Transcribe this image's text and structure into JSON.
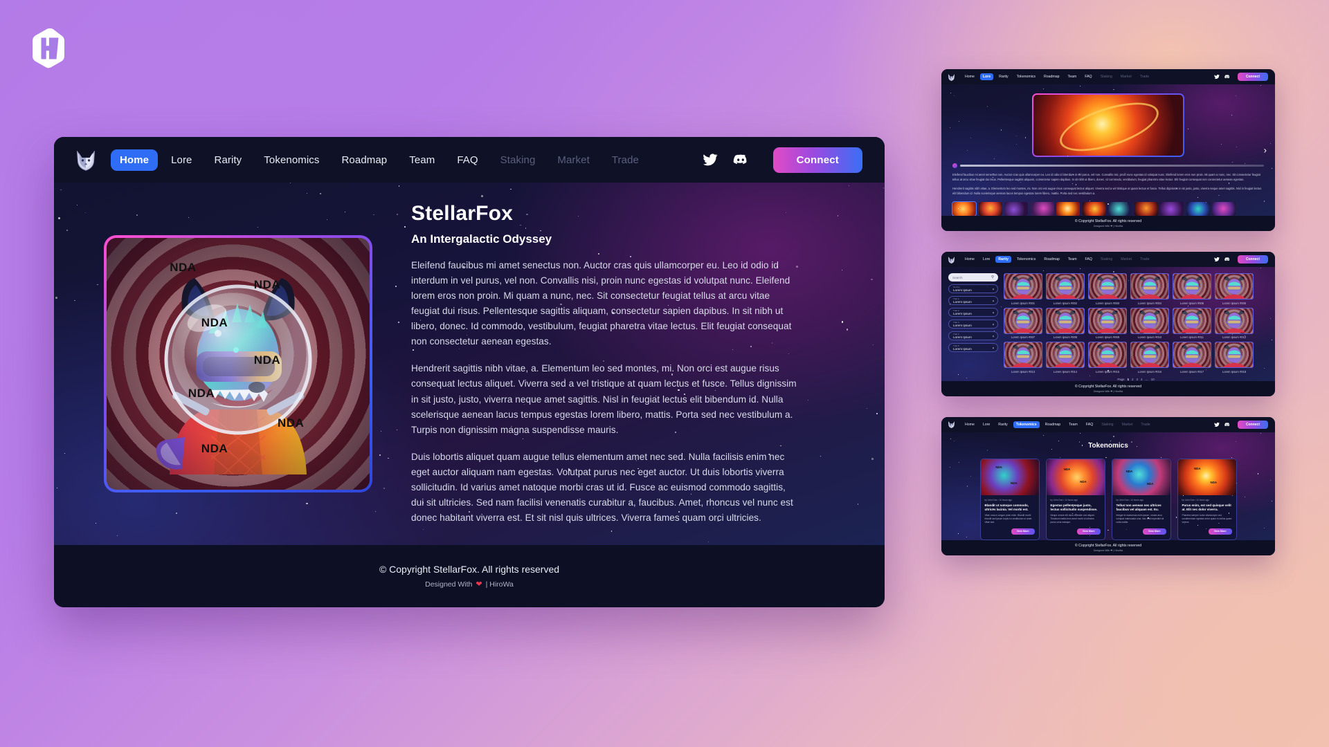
{
  "brand": {
    "logo_icon": "hw-monogram-logo",
    "name": "HW"
  },
  "main_window": {
    "nav": {
      "logo_icon": "stellarfox-fox-logo",
      "links": [
        {
          "label": "Home",
          "state": "active"
        },
        {
          "label": "Lore",
          "state": "normal"
        },
        {
          "label": "Rarity",
          "state": "normal"
        },
        {
          "label": "Tokenomics",
          "state": "normal"
        },
        {
          "label": "Roadmap",
          "state": "normal"
        },
        {
          "label": "Team",
          "state": "normal"
        },
        {
          "label": "FAQ",
          "state": "normal"
        },
        {
          "label": "Staking",
          "state": "disabled"
        },
        {
          "label": "Market",
          "state": "disabled"
        },
        {
          "label": "Trade",
          "state": "disabled"
        }
      ],
      "twitter_icon": "twitter-icon",
      "discord_icon": "discord-icon",
      "connect_label": "Connect"
    },
    "hero": {
      "artwork_watermark": "NDA",
      "title": "StellarFox",
      "subtitle": "An Intergalactic Odyssey",
      "paragraphs": [
        "Eleifend faucibus mi amet senectus non. Auctor cras quis ullamcorper eu. Leo id odio id interdum in vel purus, vel non. Convallis nisi, proin nunc egestas id volutpat nunc. Eleifend lorem eros non proin. Mi quam a nunc, nec. Sit consectetur feugiat tellus at arcu vitae feugiat dui risus. Pellentesque sagittis aliquam, consectetur sapien dapibus. In sit nibh ut libero, donec. Id commodo, vestibulum, feugiat pharetra vitae lectus. Elit feugiat consequat non consectetur aenean egestas.",
        "Hendrerit sagittis nibh vitae, a. Elementum leo sed montes, mi. Non orci est augue risus consequat lectus aliquet. Viverra sed a vel tristique at quam lectus et fusce. Tellus dignissim in sit justo, justo, viverra neque amet sagittis. Nisl in feugiat lectus elit bibendum id. Nulla scelerisque aenean lacus tempus egestas lorem libero, mattis. Porta sed nec vestibulum a. Turpis non dignissim magna suspendisse mauris.",
        "Duis lobortis aliquet quam augue tellus elementum amet nec sed. Nulla facilisis enim nec eget auctor aliquam nam egestas. Volutpat purus nec eget auctor. Ut duis lobortis viverra sollicitudin. Id varius amet natoque morbi cras ut id. Fusce ac euismod commodo sagittis, dui sit ultricies. Sed nam facilisi venenatis curabitur a, faucibus. Amet, rhoncus vel nunc est donec habitant viverra est. Et sit nisl quis ultrices. Viverra fames quam orci ultricies."
      ]
    },
    "footer": {
      "copyright": "© Copyright StellarFox. All rights reserved",
      "designed_prefix": "Designed With",
      "heart_icon": "heart-icon",
      "designed_suffix": "| HiroWa"
    }
  },
  "thumbnails": [
    {
      "page": "lore",
      "active_nav": "Lore",
      "connect_label": "Connect",
      "carousel_next_icon": "chevron-right-icon",
      "paragraphs": [
        "Eleifend faucibus mi amet senectus non. Auctor cras quis ullamcorper eu. Leo id odio id interdum in vel purus, vel non. Convallis nisi, proin nunc egestas id volutpat nunc. Eleifend lorem eros non proin. Mi quam a nunc, nec. Sit consectetur feugiat tellus at arcu vitae feugiat dui risus. Pellentesque sagittis aliquam, consectetur sapien dapibus. In sit nibh ut libero, donec. Id commodo, vestibulum, feugiat pharetra vitae lectus. Elit feugiat consequat non consectetur aenean egestas.",
        "Hendrerit sagittis nibh vitae, a. Elementum leo sed montes, mi. Non orci est augue risus consequat lectus aliquet. Viverra sed a vel tristique at quam lectus et fusce. Tellus dignissim in sit justo, justo, viverra neque amet sagittis. Nisl in feugiat lectus elit bibendum id. Nulla scelerisque aenean lacus tempus egestas lorem libero, mattis. Porta sed nec vestibulum a."
      ],
      "copyright": "© Copyright StellarFox. All rights reserved",
      "designed": "Designed With ❤ | HiroWa"
    },
    {
      "page": "rarity",
      "active_nav": "Rarity",
      "connect_label": "Connect",
      "search_placeholder": "Search",
      "search_icon": "magnifier-icon",
      "filters": [
        {
          "label": "Sort by",
          "value": "Lorem Ipsum"
        },
        {
          "label": "Trait 1",
          "value": "Lorem Ipsum"
        },
        {
          "label": "Trait 2",
          "value": "Lorem Ipsum"
        },
        {
          "label": "Trait 3",
          "value": "Lorem Ipsum"
        },
        {
          "label": "Trait 4",
          "value": "Lorem Ipsum"
        },
        {
          "label": "Trait 5",
          "value": "Lorem Ipsum"
        }
      ],
      "cards": [
        "Lorem Ipsum #001",
        "Lorem Ipsum #002",
        "Lorem Ipsum #003",
        "Lorem Ipsum #004",
        "Lorem Ipsum #005",
        "Lorem Ipsum #006",
        "Lorem Ipsum #007",
        "Lorem Ipsum #008",
        "Lorem Ipsum #009",
        "Lorem Ipsum #010",
        "Lorem Ipsum #011",
        "Lorem Ipsum #012",
        "Lorem Ipsum #013",
        "Lorem Ipsum #014",
        "Lorem Ipsum #015",
        "Lorem Ipsum #016",
        "Lorem Ipsum #017",
        "Lorem Ipsum #018"
      ],
      "pagination": {
        "label": "Page",
        "pages": [
          "1",
          "2",
          "3",
          "4",
          "…",
          "10"
        ],
        "current": "1"
      },
      "copyright": "© Copyright StellarFox. All rights reserved",
      "designed": "Designed With ❤ | HiroWa"
    },
    {
      "page": "tokenomics",
      "active_nav": "Tokenomics",
      "connect_label": "Connect",
      "title": "Tokenomics",
      "cards": [
        {
          "byline": "by John Doe • 14 hours ago",
          "headline": "Blandit ut natoque commodo, ultrices lacinia. Vel morbi est.",
          "body": "Vitae urna a congue proin enim. Blandit morbi blandit sed ipsum turpis eu vestibulum ut amet. Vitae sed.",
          "button": "View More",
          "watermark": "NDA"
        },
        {
          "byline": "by John Doe • 14 hours ago",
          "headline": "Egestas pellentesque justo, lectus sollicitudin suspendisse.",
          "body": "Neque ornare elit risus molestie orci aliquet. Tincidunt mattis leon amet morbi id ultricies purus urna natoque.",
          "button": "View More",
          "watermark": "NDA"
        },
        {
          "byline": "by John Doe • 14 hours ago",
          "headline": "Tellus non aenean nec ultrices faucibus vel aliquam est. Eu.",
          "body": "Integer id maecenas enim ipsum, ornare arcu volutpat malesuada cras. Nec erat imperdiet sit nulla mattis.",
          "button": "View More",
          "watermark": "NDA"
        },
        {
          "byline": "by John Doe • 14 hours ago",
          "headline": "Purus enim, est sed quisque velit at. Elit nec dolor viverra.",
          "body": "Pharetra semper tortor ullamcorper orci condimentum egestas enim quam eu tellus quam viverra.",
          "button": "View More",
          "watermark": "NDA"
        }
      ],
      "copyright": "© Copyright StellarFox. All rights reserved",
      "designed": "Designed With ❤ | HiroWa"
    }
  ],
  "colors": {
    "accent_blue": "#2f6df6",
    "gradient_pink": "#e14bc4",
    "gradient_purple": "#9b4ae0",
    "gradient_blue": "#3b6ef5",
    "dark_bg": "#0d1024",
    "nav_bg": "#0f1226"
  }
}
